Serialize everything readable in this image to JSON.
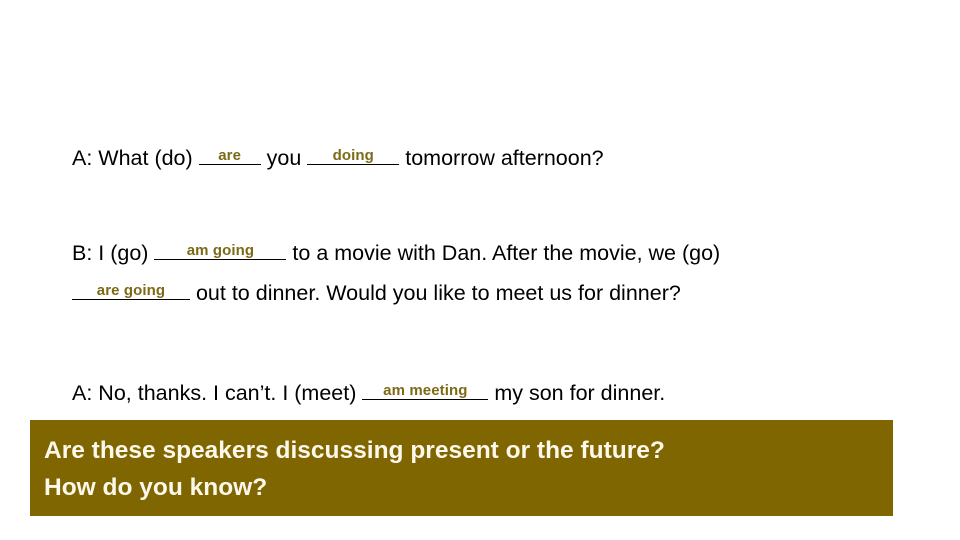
{
  "slide": {
    "background_color": "#ffffff",
    "answer_color": "#7d6a17",
    "banner_color": "#806600",
    "banner_text_color": "#fdf8ec"
  },
  "exercise": {
    "items": [
      {
        "id": "line-a1",
        "segments": [
          {
            "type": "text",
            "value": "A: What (do) "
          },
          {
            "type": "blank",
            "answer": "are"
          },
          {
            "type": "text",
            "value": " you "
          },
          {
            "type": "blank",
            "answer": "doing"
          },
          {
            "type": "text",
            "value": " tomorrow afternoon?"
          }
        ]
      },
      {
        "id": "line-b1",
        "segments": [
          {
            "type": "text",
            "value": "B: I  (go) "
          },
          {
            "type": "blank",
            "answer": "am going"
          },
          {
            "type": "text",
            "value": " to a movie with Dan.  After the movie, we (go)"
          }
        ]
      },
      {
        "id": "line-b2",
        "segments": [
          {
            "type": "blank",
            "answer": "are going"
          },
          {
            "type": "text",
            "value": " out to dinner. Would you like to meet us for dinner?"
          }
        ]
      },
      {
        "id": "line-a2",
        "segments": [
          {
            "type": "text",
            "value": "A: No, thanks. I can’t. I (meet) "
          },
          {
            "type": "blank",
            "answer": "am meeting"
          },
          {
            "type": "text",
            "value": " my son for dinner."
          }
        ]
      }
    ],
    "line_a1_text_1": "A: What (do) ",
    "line_a1_blank_1": "are",
    "line_a1_text_2": " you ",
    "line_a1_blank_2": "doing",
    "line_a1_text_3": " tomorrow afternoon?",
    "line_b1_text_1": "B: I  (go) ",
    "line_b1_blank_1": "am going",
    "line_b1_text_2": " to a movie with Dan.  After the movie, we (go)",
    "line_b2_blank_1": "are going",
    "line_b2_text_1": " out to dinner. Would you like to meet us for dinner?",
    "line_a2_text_1": "A: No, thanks. I can’t. I (meet) ",
    "line_a2_blank_1": "am meeting",
    "line_a2_text_2": " my son for dinner."
  },
  "banner": {
    "line1": "Are these speakers discussing present or the future?",
    "line2": "How do you know?"
  }
}
